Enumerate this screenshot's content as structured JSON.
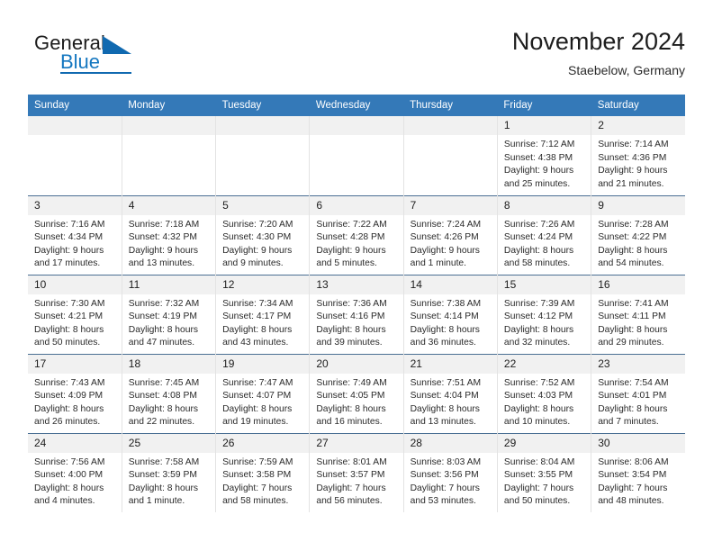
{
  "brand": {
    "name_part1": "General",
    "name_part2": "Blue"
  },
  "header": {
    "title": "November 2024",
    "subtitle": "Staebelow, Germany"
  },
  "colors": {
    "header_blue": "#3479b8",
    "logo_blue": "#1069b0",
    "daynum_band": "#f1f1f1",
    "row_rule": "#4a6f93"
  },
  "weekday_headers": [
    "Sunday",
    "Monday",
    "Tuesday",
    "Wednesday",
    "Thursday",
    "Friday",
    "Saturday"
  ],
  "labels": {
    "sunrise_prefix": "Sunrise:",
    "sunset_prefix": "Sunset:",
    "daylight_prefix": "Daylight:"
  },
  "weeks": [
    [
      {
        "day": "",
        "sunrise": "",
        "sunset": "",
        "daylight": "",
        "empty": true
      },
      {
        "day": "",
        "sunrise": "",
        "sunset": "",
        "daylight": "",
        "empty": true
      },
      {
        "day": "",
        "sunrise": "",
        "sunset": "",
        "daylight": "",
        "empty": true
      },
      {
        "day": "",
        "sunrise": "",
        "sunset": "",
        "daylight": "",
        "empty": true
      },
      {
        "day": "",
        "sunrise": "",
        "sunset": "",
        "daylight": "",
        "empty": true
      },
      {
        "day": "1",
        "sunrise": "Sunrise: 7:12 AM",
        "sunset": "Sunset: 4:38 PM",
        "daylight": "Daylight: 9 hours and 25 minutes."
      },
      {
        "day": "2",
        "sunrise": "Sunrise: 7:14 AM",
        "sunset": "Sunset: 4:36 PM",
        "daylight": "Daylight: 9 hours and 21 minutes."
      }
    ],
    [
      {
        "day": "3",
        "sunrise": "Sunrise: 7:16 AM",
        "sunset": "Sunset: 4:34 PM",
        "daylight": "Daylight: 9 hours and 17 minutes."
      },
      {
        "day": "4",
        "sunrise": "Sunrise: 7:18 AM",
        "sunset": "Sunset: 4:32 PM",
        "daylight": "Daylight: 9 hours and 13 minutes."
      },
      {
        "day": "5",
        "sunrise": "Sunrise: 7:20 AM",
        "sunset": "Sunset: 4:30 PM",
        "daylight": "Daylight: 9 hours and 9 minutes."
      },
      {
        "day": "6",
        "sunrise": "Sunrise: 7:22 AM",
        "sunset": "Sunset: 4:28 PM",
        "daylight": "Daylight: 9 hours and 5 minutes."
      },
      {
        "day": "7",
        "sunrise": "Sunrise: 7:24 AM",
        "sunset": "Sunset: 4:26 PM",
        "daylight": "Daylight: 9 hours and 1 minute."
      },
      {
        "day": "8",
        "sunrise": "Sunrise: 7:26 AM",
        "sunset": "Sunset: 4:24 PM",
        "daylight": "Daylight: 8 hours and 58 minutes."
      },
      {
        "day": "9",
        "sunrise": "Sunrise: 7:28 AM",
        "sunset": "Sunset: 4:22 PM",
        "daylight": "Daylight: 8 hours and 54 minutes."
      }
    ],
    [
      {
        "day": "10",
        "sunrise": "Sunrise: 7:30 AM",
        "sunset": "Sunset: 4:21 PM",
        "daylight": "Daylight: 8 hours and 50 minutes."
      },
      {
        "day": "11",
        "sunrise": "Sunrise: 7:32 AM",
        "sunset": "Sunset: 4:19 PM",
        "daylight": "Daylight: 8 hours and 47 minutes."
      },
      {
        "day": "12",
        "sunrise": "Sunrise: 7:34 AM",
        "sunset": "Sunset: 4:17 PM",
        "daylight": "Daylight: 8 hours and 43 minutes."
      },
      {
        "day": "13",
        "sunrise": "Sunrise: 7:36 AM",
        "sunset": "Sunset: 4:16 PM",
        "daylight": "Daylight: 8 hours and 39 minutes."
      },
      {
        "day": "14",
        "sunrise": "Sunrise: 7:38 AM",
        "sunset": "Sunset: 4:14 PM",
        "daylight": "Daylight: 8 hours and 36 minutes."
      },
      {
        "day": "15",
        "sunrise": "Sunrise: 7:39 AM",
        "sunset": "Sunset: 4:12 PM",
        "daylight": "Daylight: 8 hours and 32 minutes."
      },
      {
        "day": "16",
        "sunrise": "Sunrise: 7:41 AM",
        "sunset": "Sunset: 4:11 PM",
        "daylight": "Daylight: 8 hours and 29 minutes."
      }
    ],
    [
      {
        "day": "17",
        "sunrise": "Sunrise: 7:43 AM",
        "sunset": "Sunset: 4:09 PM",
        "daylight": "Daylight: 8 hours and 26 minutes."
      },
      {
        "day": "18",
        "sunrise": "Sunrise: 7:45 AM",
        "sunset": "Sunset: 4:08 PM",
        "daylight": "Daylight: 8 hours and 22 minutes."
      },
      {
        "day": "19",
        "sunrise": "Sunrise: 7:47 AM",
        "sunset": "Sunset: 4:07 PM",
        "daylight": "Daylight: 8 hours and 19 minutes."
      },
      {
        "day": "20",
        "sunrise": "Sunrise: 7:49 AM",
        "sunset": "Sunset: 4:05 PM",
        "daylight": "Daylight: 8 hours and 16 minutes."
      },
      {
        "day": "21",
        "sunrise": "Sunrise: 7:51 AM",
        "sunset": "Sunset: 4:04 PM",
        "daylight": "Daylight: 8 hours and 13 minutes."
      },
      {
        "day": "22",
        "sunrise": "Sunrise: 7:52 AM",
        "sunset": "Sunset: 4:03 PM",
        "daylight": "Daylight: 8 hours and 10 minutes."
      },
      {
        "day": "23",
        "sunrise": "Sunrise: 7:54 AM",
        "sunset": "Sunset: 4:01 PM",
        "daylight": "Daylight: 8 hours and 7 minutes."
      }
    ],
    [
      {
        "day": "24",
        "sunrise": "Sunrise: 7:56 AM",
        "sunset": "Sunset: 4:00 PM",
        "daylight": "Daylight: 8 hours and 4 minutes."
      },
      {
        "day": "25",
        "sunrise": "Sunrise: 7:58 AM",
        "sunset": "Sunset: 3:59 PM",
        "daylight": "Daylight: 8 hours and 1 minute."
      },
      {
        "day": "26",
        "sunrise": "Sunrise: 7:59 AM",
        "sunset": "Sunset: 3:58 PM",
        "daylight": "Daylight: 7 hours and 58 minutes."
      },
      {
        "day": "27",
        "sunrise": "Sunrise: 8:01 AM",
        "sunset": "Sunset: 3:57 PM",
        "daylight": "Daylight: 7 hours and 56 minutes."
      },
      {
        "day": "28",
        "sunrise": "Sunrise: 8:03 AM",
        "sunset": "Sunset: 3:56 PM",
        "daylight": "Daylight: 7 hours and 53 minutes."
      },
      {
        "day": "29",
        "sunrise": "Sunrise: 8:04 AM",
        "sunset": "Sunset: 3:55 PM",
        "daylight": "Daylight: 7 hours and 50 minutes."
      },
      {
        "day": "30",
        "sunrise": "Sunrise: 8:06 AM",
        "sunset": "Sunset: 3:54 PM",
        "daylight": "Daylight: 7 hours and 48 minutes."
      }
    ]
  ]
}
